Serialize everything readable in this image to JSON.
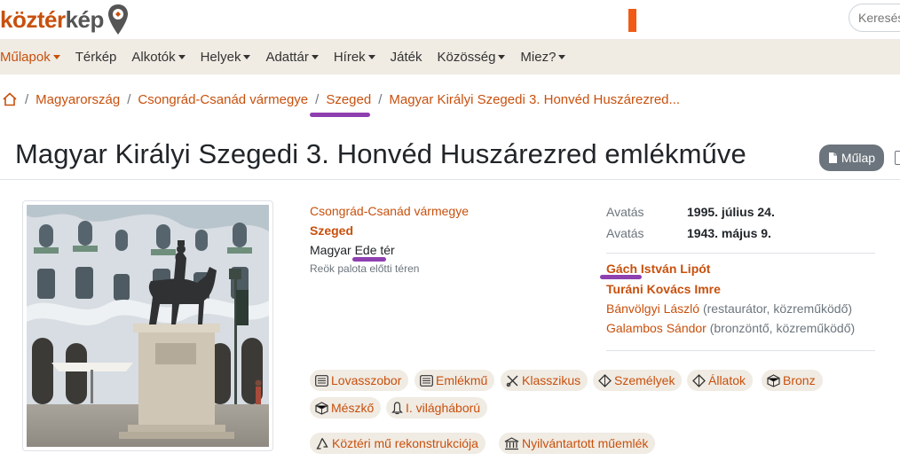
{
  "brand": {
    "part1": "köztér",
    "part2": "kép"
  },
  "search": {
    "placeholder": "Keresés"
  },
  "nav": {
    "items": [
      {
        "label": "Műlapok",
        "caret": true,
        "active": true
      },
      {
        "label": "Térkép",
        "caret": false
      },
      {
        "label": "Alkotók",
        "caret": true
      },
      {
        "label": "Helyek",
        "caret": true
      },
      {
        "label": "Adattár",
        "caret": true
      },
      {
        "label": "Hírek",
        "caret": true
      },
      {
        "label": "Játék",
        "caret": false
      },
      {
        "label": "Közösség",
        "caret": true
      },
      {
        "label": "Miez?",
        "caret": true
      }
    ]
  },
  "breadcrumb": {
    "items": [
      "Magyarország",
      "Csongrád-Csanád vármegye",
      "Szeged",
      "Magyar Királyi Szegedi 3. Honvéd Huszárezred..."
    ]
  },
  "page": {
    "title": "Magyar Királyi Szegedi 3. Honvéd Huszárezred emlékműve",
    "mulap_button": "Műlap"
  },
  "location": {
    "county": "Csongrád-Csanád vármegye",
    "city": "Szeged",
    "street": "Magyar Ede tér",
    "note": "Reök palota előtti téren"
  },
  "dates": [
    {
      "label": "Avatás",
      "value": "1995. július 24."
    },
    {
      "label": "Avatás",
      "value": "1943. május 9."
    }
  ],
  "artists": [
    {
      "name": "Gách István Lipót",
      "role": "",
      "bold": true
    },
    {
      "name": "Turáni Kovács Imre",
      "role": "",
      "bold": true
    },
    {
      "name": "Bánvölgyi László",
      "role": " (restaurátor, közreműködő)",
      "bold": false
    },
    {
      "name": "Galambos Sándor",
      "role": " (bronzöntő, közreműködő)",
      "bold": false
    }
  ],
  "tags": [
    {
      "label": "Lovasszobor",
      "icon": "list-icon"
    },
    {
      "label": "Emlékmű",
      "icon": "list-icon"
    },
    {
      "label": "Klasszikus",
      "icon": "brush-icon"
    },
    {
      "label": "Személyek",
      "icon": "diamond-icon"
    },
    {
      "label": "Állatok",
      "icon": "diamond-icon"
    },
    {
      "label": "Bronz",
      "icon": "cube-icon"
    },
    {
      "label": "Mészkő",
      "icon": "cube-icon"
    },
    {
      "label": "I. világháború",
      "icon": "bell-icon"
    },
    {
      "label": "Köztéri mű rekonstrukciója",
      "icon": "recycle-icon"
    },
    {
      "label": "Nyilvántartott műemlék",
      "icon": "bank-icon"
    }
  ],
  "colors": {
    "accent": "#c8500d",
    "nav_bg": "#f0ebe3",
    "annotation_underline": "#8e3fb0",
    "button_gray": "#6c757d"
  }
}
